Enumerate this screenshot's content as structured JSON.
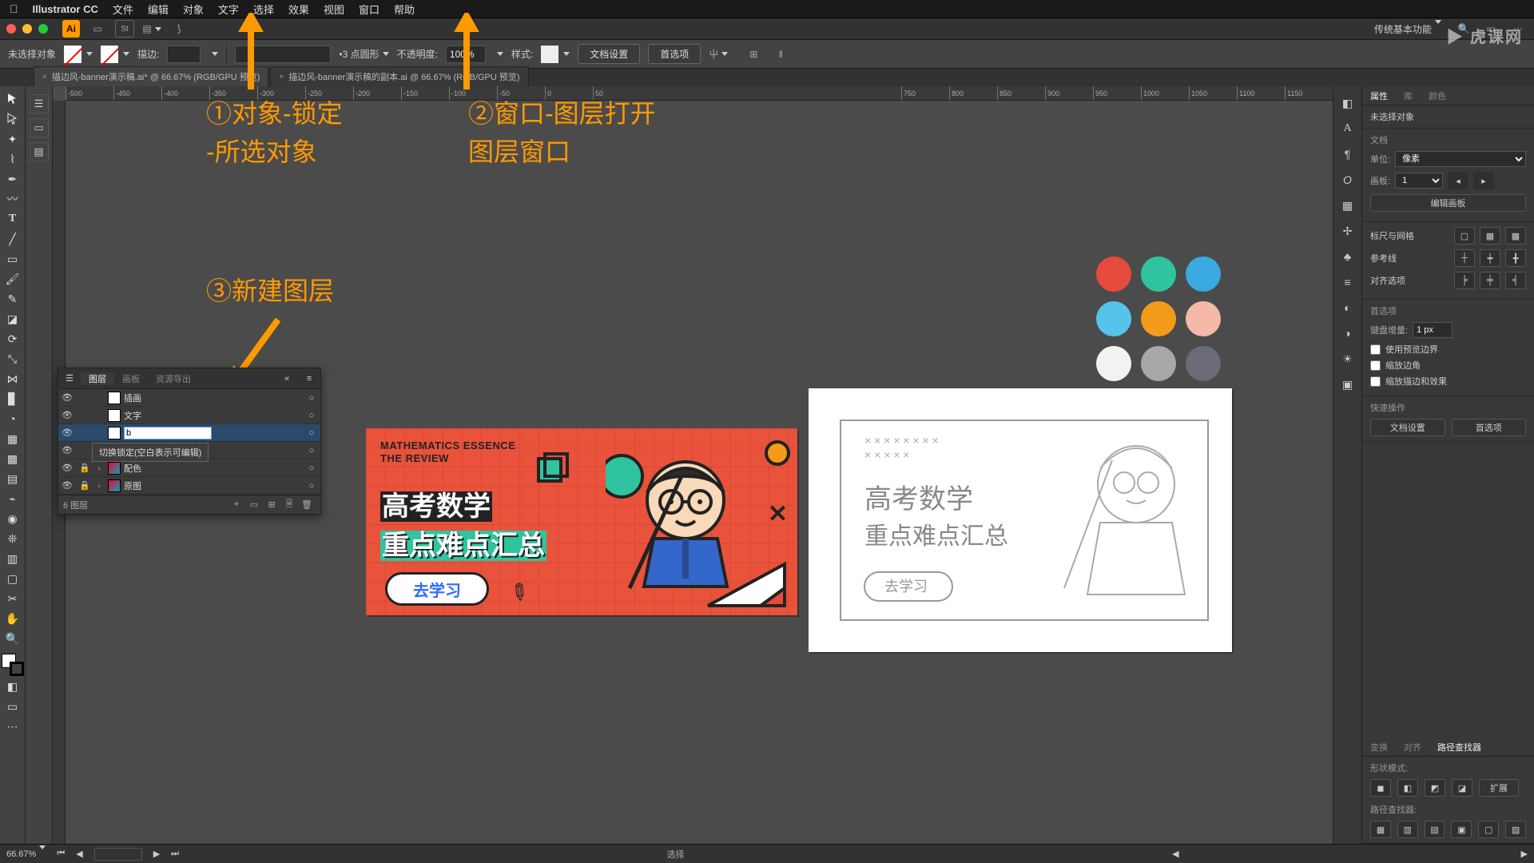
{
  "menubar": {
    "app": "Illustrator CC",
    "items": [
      "文件",
      "编辑",
      "对象",
      "文字",
      "选择",
      "效果",
      "视图",
      "窗口",
      "帮助"
    ]
  },
  "titlebar": {
    "workspace": "传统基本功能"
  },
  "ctrlbar": {
    "noSelection": "未选择对象",
    "strokeLabel": "描边:",
    "strokeVal": "",
    "brushLabel": "",
    "brushVal": "3 点圆形",
    "opacityLabel": "不透明度:",
    "opacityVal": "100%",
    "styleLabel": "样式:",
    "docSetup": "文档设置",
    "prefs": "首选项"
  },
  "tabs": [
    "描边风-banner演示稿.ai* @ 66.67% (RGB/GPU 预览)",
    "描边风-banner演示稿的副本.ai @ 66.67% (RGB/GPU 预览)"
  ],
  "ruler": [
    "-500",
    "-450",
    "-400",
    "-350",
    "-300",
    "-250",
    "-200",
    "-150",
    "-100",
    "-50",
    "0",
    "50",
    "750",
    "800",
    "850",
    "900",
    "950",
    "1000",
    "1050",
    "1100",
    "1150"
  ],
  "layers": {
    "tab1": "图层",
    "tab2": "画板",
    "tab3": "资源导出",
    "items": [
      {
        "name": "插画",
        "exp": "",
        "thumb": "w"
      },
      {
        "name": "文字",
        "exp": "",
        "thumb": "w"
      },
      {
        "name": "b",
        "editing": true,
        "thumb": "w"
      },
      {
        "name": "",
        "exp": "›",
        "thumb": "w"
      },
      {
        "name": "配色",
        "exp": "›",
        "thumb": "img",
        "lock": true
      },
      {
        "name": "原图",
        "exp": "›",
        "thumb": "img",
        "lock": true
      }
    ],
    "tooltip": "切换锁定(空白表示可编辑)",
    "count": "6 图层"
  },
  "anno": {
    "a1a": "①对象-锁定",
    "a1b": "-所选对象",
    "a2a": "②窗口-图层打开",
    "a2b": "图层窗口",
    "a3": "③新建图层"
  },
  "banner": {
    "mathA": "MATHEMATICS ESSENCE",
    "mathB": "THE REVIEW",
    "cnA": "高考数学",
    "cnB": "重点难点汇总",
    "go": "去学习",
    "sketchA": "高考数学",
    "sketchB": "重点难点汇总",
    "sketchGo": "去学习"
  },
  "palette": [
    "#e64a3b",
    "#2fc49f",
    "#3aa9e0",
    "#55c3ea",
    "#f49b1b",
    "#f5b9a9",
    "#f2f2f2",
    "#a8a8a8",
    "#6b6b77"
  ],
  "props": {
    "tabProps": "属性",
    "tabLib": "库",
    "tabColor": "颜色",
    "noSel": "未选择对象",
    "doc": "文档",
    "unitLabel": "单位:",
    "unitVal": "像素",
    "artboardLabel": "画板:",
    "artboardVal": "1",
    "editArtboard": "编辑画板",
    "rulerGrid": "标尺与网格",
    "guides": "参考线",
    "alignOpts": "对齐选项",
    "prefsSect": "首选项",
    "keyIncLabel": "键盘增量:",
    "keyIncVal": "1 px",
    "chk1": "使用预览边界",
    "chk2": "缩放边角",
    "chk3": "缩放描边和效果",
    "quick": "快速操作",
    "qDoc": "文档设置",
    "qPref": "首选项"
  },
  "pf": {
    "tabT": "变换",
    "tabA": "对齐",
    "tabP": "路径查找器",
    "shapeMode": "形状模式:",
    "expand": "扩展",
    "pfLabel": "路径查找器:"
  },
  "status": {
    "zoom": "66.67%",
    "sel": "选择"
  },
  "watermark": "虎课网"
}
